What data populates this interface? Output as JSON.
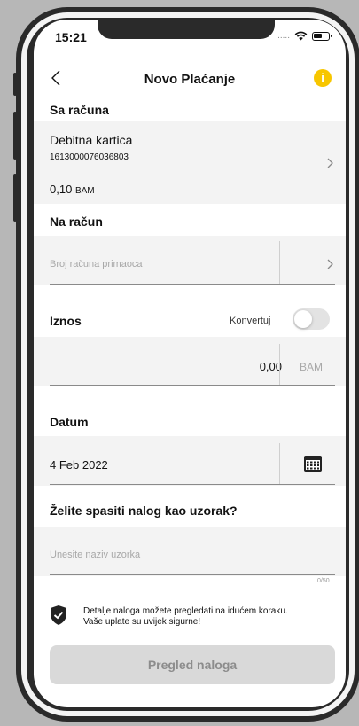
{
  "status_bar": {
    "time": "15:21",
    "signal": "....."
  },
  "header": {
    "title": "Novo Plaćanje",
    "info": "i"
  },
  "from_account": {
    "section_label": "Sa računa",
    "name": "Debitna kartica",
    "number": "1613000076036803",
    "balance": "0,10",
    "currency": "BAM"
  },
  "to_account": {
    "section_label": "Na račun",
    "placeholder": "Broj računa primaoca"
  },
  "amount": {
    "section_label": "Iznos",
    "convert_label": "Konvertuj",
    "value": "0,00",
    "currency": "BAM"
  },
  "date": {
    "section_label": "Datum",
    "value": "4 Feb 2022"
  },
  "template": {
    "section_label": "Želite spasiti nalog kao uzorak?",
    "placeholder": "Unesite naziv uzorka",
    "counter": "0/50"
  },
  "notice": {
    "line1": "Detalje naloga možete pregledati na idućem koraku.",
    "line2": "Vaše uplate su uvijek sigurne!"
  },
  "actions": {
    "review_label": "Pregled naloga"
  },
  "colors": {
    "accent": "#f7c600",
    "button_disabled": "#d9d9d9",
    "section_bg": "#f3f3f3"
  }
}
